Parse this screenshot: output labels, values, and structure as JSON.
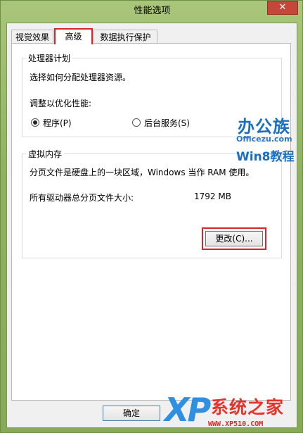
{
  "window": {
    "title": "性能选项",
    "close_glyph": "✕"
  },
  "tabs": [
    {
      "label": "视觉效果",
      "active": false
    },
    {
      "label": "高级",
      "active": true
    },
    {
      "label": "数据执行保护",
      "active": false
    }
  ],
  "processor": {
    "group_title": "处理器计划",
    "description": "选择如何分配处理器资源。",
    "adjust_label": "调整以优化性能:",
    "options": [
      {
        "label": "程序(P)",
        "selected": true
      },
      {
        "label": "后台服务(S)",
        "selected": false
      }
    ]
  },
  "virtual_memory": {
    "group_title": "虚拟内存",
    "description": "分页文件是硬盘上的一块区域，Windows 当作 RAM 使用。",
    "total_label": "所有驱动器总分页文件大小:",
    "total_value": "1792 MB",
    "change_label": "更改(C)..."
  },
  "footer": {
    "ok_label": "确定"
  },
  "watermarks": {
    "officezu_name": "办公族",
    "officezu_site": "Officezu.com",
    "officezu_win": "Win8教程",
    "xp_logo": "XP",
    "xp_brand": "系统之家",
    "xp_url": "WWW.XP510.COM"
  },
  "colors": {
    "highlight": "#d8242a",
    "desktop": "#8fb262"
  }
}
